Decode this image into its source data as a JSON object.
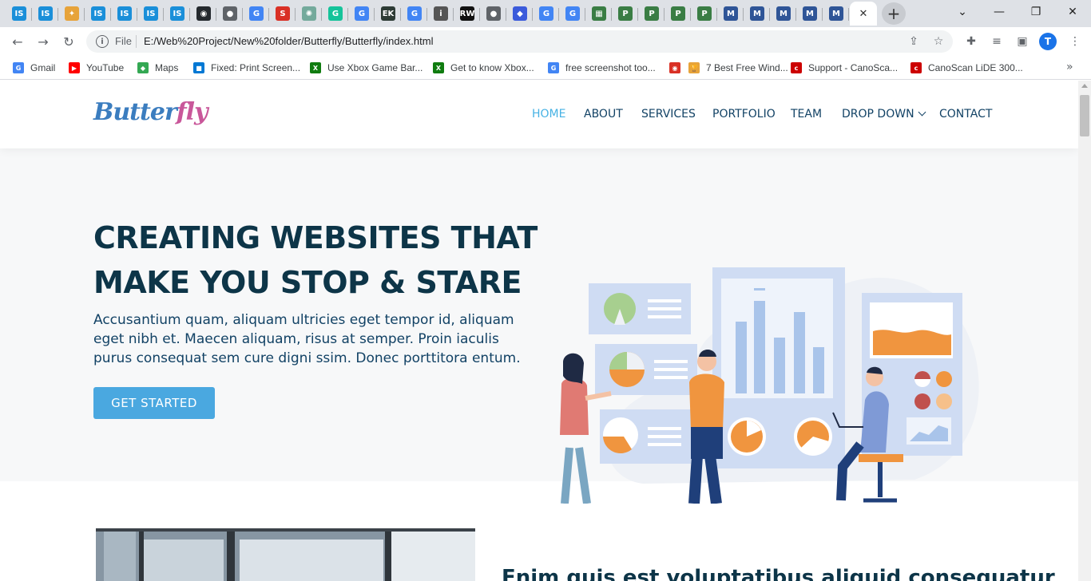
{
  "browser": {
    "tabs": [
      {
        "icon": "IS",
        "color": "#1a8fd9"
      },
      {
        "icon": "IS",
        "color": "#1a8fd9"
      },
      {
        "icon": "✦",
        "color": "#e7a33a"
      },
      {
        "icon": "IS",
        "color": "#1a8fd9"
      },
      {
        "icon": "IS",
        "color": "#1a8fd9"
      },
      {
        "icon": "IS",
        "color": "#1a8fd9"
      },
      {
        "icon": "IS",
        "color": "#1a8fd9"
      },
      {
        "icon": "◉",
        "color": "#24292e"
      },
      {
        "icon": "●",
        "color": "#5f6368"
      },
      {
        "icon": "G",
        "color": "#4285f4"
      },
      {
        "icon": "S",
        "color": "#d93025"
      },
      {
        "icon": "✺",
        "color": "#74aa9c"
      },
      {
        "icon": "G",
        "color": "#15c39a"
      },
      {
        "icon": "G",
        "color": "#4285f4"
      },
      {
        "icon": "EK",
        "color": "#2d3b35"
      },
      {
        "icon": "G",
        "color": "#4285f4"
      },
      {
        "icon": "i",
        "color": "#555555"
      },
      {
        "icon": "RW",
        "color": "#111111"
      },
      {
        "icon": "●",
        "color": "#5f6368"
      },
      {
        "icon": "◆",
        "color": "#3b5bdb"
      },
      {
        "icon": "G",
        "color": "#4285f4"
      },
      {
        "icon": "G",
        "color": "#4285f4"
      },
      {
        "icon": "▦",
        "color": "#3a7d44"
      },
      {
        "icon": "P",
        "color": "#3a7d44"
      },
      {
        "icon": "P",
        "color": "#3a7d44"
      },
      {
        "icon": "P",
        "color": "#3a7d44"
      },
      {
        "icon": "P",
        "color": "#3a7d44"
      },
      {
        "icon": "M",
        "color": "#2f5597"
      },
      {
        "icon": "M",
        "color": "#2f5597"
      },
      {
        "icon": "M",
        "color": "#2f5597"
      },
      {
        "icon": "M",
        "color": "#2f5597"
      },
      {
        "icon": "M",
        "color": "#2f5597"
      }
    ],
    "active_tab_close": "✕",
    "new_tab": "+",
    "window_controls": {
      "menu": "⌄",
      "minimize": "—",
      "restore": "❐",
      "close": "✕"
    },
    "omnibox": {
      "info": "i",
      "scheme_label": "File",
      "url": "E:/Web%20Project/New%20folder/Butterfly/Butterfly/index.html"
    },
    "profile_initial": "T",
    "bookmarks": [
      {
        "label": "Gmail",
        "icon": "G",
        "color": "#4285f4"
      },
      {
        "label": "YouTube",
        "icon": "▶",
        "color": "#ff0000"
      },
      {
        "label": "Maps",
        "icon": "◆",
        "color": "#34a853"
      },
      {
        "label": "Fixed: Print Screen...",
        "icon": "■",
        "color": "#0078d4"
      },
      {
        "label": "Use Xbox Game Bar...",
        "icon": "X",
        "color": "#107c10"
      },
      {
        "label": "Get to know Xbox...",
        "icon": "X",
        "color": "#107c10"
      },
      {
        "label": "free screenshot too...",
        "icon": "G",
        "color": "#4285f4"
      },
      {
        "label": "",
        "icon": "◉",
        "color": "#d93025"
      },
      {
        "label": "7 Best Free Wind...",
        "icon": "🏆",
        "color": "#e7a33a"
      },
      {
        "label": "Support - CanoSca...",
        "icon": "c",
        "color": "#cc0000"
      },
      {
        "label": "CanoScan LiDE 300...",
        "icon": "c",
        "color": "#cc0000"
      }
    ],
    "bookmarks_more": "»"
  },
  "site": {
    "logo": {
      "part1": "Butter",
      "part2": "fly"
    },
    "nav": [
      {
        "label": "HOME",
        "active": true
      },
      {
        "label": "ABOUT",
        "active": false
      },
      {
        "label": "SERVICES",
        "active": false
      },
      {
        "label": "PORTFOLIO",
        "active": false
      },
      {
        "label": "TEAM",
        "active": false
      },
      {
        "label": "DROP DOWN",
        "active": false
      },
      {
        "label": "CONTACT",
        "active": false
      }
    ],
    "hero": {
      "title": "CREATING WEBSITES THAT MAKE YOU STOP & STARE",
      "text": "Accusantium quam, aliquam ultricies eget tempor id, aliquam eget nibh et. Maecen aliquam, risus at semper. Proin iaculis purus consequat sem cure digni ssim. Donec porttitora entum.",
      "cta": "GET STARTED"
    },
    "about": {
      "title": "Enim quis est voluptatibus aliquid consequatur"
    }
  },
  "colors": {
    "accent": "#47b2e4",
    "heading": "#0d3548",
    "body_text": "#124265",
    "hero_bg": "#f7f8f9",
    "illus_orange": "#f0953f",
    "illus_blue": "#a9c4ea"
  }
}
